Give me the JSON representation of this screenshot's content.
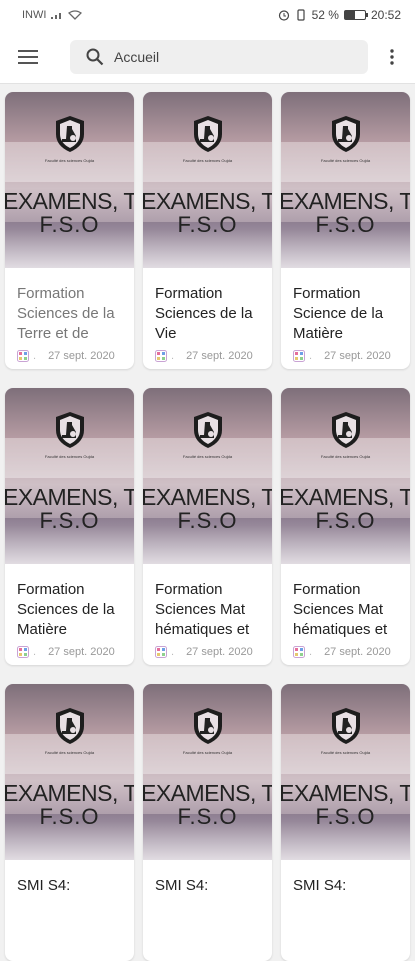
{
  "status_bar": {
    "carrier": "INWI",
    "battery": "52 %",
    "time": "20:52",
    "battery_fraction": 0.52
  },
  "header": {
    "search_placeholder": "Accueil"
  },
  "cards": [
    {
      "line1": "EXAMENS, TD",
      "line2": "F.S.O",
      "title": "Formation Sciences de la Terre et de",
      "date": "27 sept. 2020",
      "faded": true
    },
    {
      "line1": "EXAMENS, TD",
      "line2": "F.S.O",
      "title": "Formation Sciences de la Vie",
      "date": "27 sept. 2020",
      "faded": false
    },
    {
      "line1": "EXAMENS, TD",
      "line2": "F.S.O",
      "title": "Formation Science de la Matière",
      "date": "27 sept. 2020",
      "faded": false
    },
    {
      "line1": "EXAMENS, TD",
      "line2": "F.S.O",
      "title": "Formation Sciences de la Matière",
      "date": "27 sept. 2020",
      "faded": false
    },
    {
      "line1": "EXAMENS, TD",
      "line2": "F.S.O",
      "title": "Formation Sciences Mat hématiques et",
      "date": "27 sept. 2020",
      "faded": false
    },
    {
      "line1": "EXAMENS, TD",
      "line2": "F.S.O",
      "title": "Formation Sciences Mat hématiques et",
      "date": "27 sept. 2020",
      "faded": false
    },
    {
      "line1": "EXAMENS, TD",
      "line2": "F.S.O",
      "title": "SMI S4:",
      "date": "",
      "faded": false
    },
    {
      "line1": "EXAMENS, TD",
      "line2": "F.S.O",
      "title": "SMI S4:",
      "date": "",
      "faded": false
    },
    {
      "line1": "EXAMENS, TD",
      "line2": "F.S.O",
      "title": "SMI S4:",
      "date": "",
      "faded": false
    }
  ]
}
